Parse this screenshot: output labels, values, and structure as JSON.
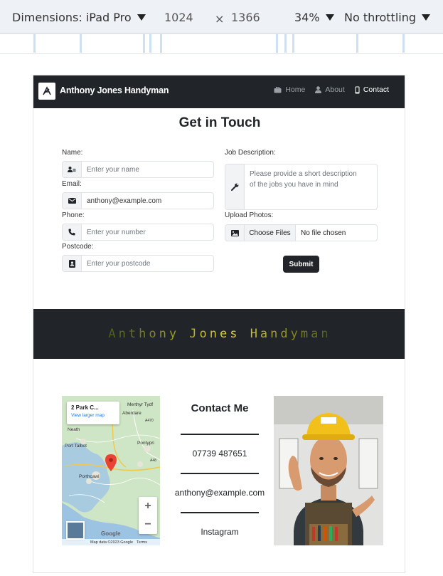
{
  "devtools": {
    "dimensions_label": "Dimensions: iPad Pro",
    "width": "1024",
    "times": "×",
    "height": "1366",
    "zoom": "34%",
    "throttling": "No throttling"
  },
  "nav": {
    "brand": "Anthony Jones Handyman",
    "links": [
      {
        "label": "Home",
        "icon": "briefcase-icon"
      },
      {
        "label": "About",
        "icon": "person-icon"
      },
      {
        "label": "Contact",
        "icon": "phone-icon"
      }
    ]
  },
  "form": {
    "title": "Get in Touch",
    "name": {
      "label": "Name:",
      "placeholder": "Enter your name"
    },
    "email": {
      "label": "Email:",
      "value": "anthony@example.com"
    },
    "phone": {
      "label": "Phone:",
      "placeholder": "Enter your number"
    },
    "postcode": {
      "label": "Postcode:",
      "placeholder": "Enter your postcode"
    },
    "job": {
      "label": "Job Description:",
      "placeholder_line1": "Please provide a short description",
      "placeholder_line2": "of the jobs you have in mind"
    },
    "photos": {
      "label": "Upload Photos:",
      "button": "Choose Files",
      "status": "No file chosen"
    },
    "submit": "Submit"
  },
  "banner": {
    "text": "Anthony Jones Handyman"
  },
  "map": {
    "card_title": "2 Park C...",
    "card_link": "View larger map",
    "places": [
      "Merthyr Tydf",
      "Aberdare",
      "Neath",
      "Port Talbot",
      "Pontypri",
      "Porthcawl",
      "A470",
      "A48"
    ],
    "footer_data": "Map data ©2023 Google",
    "footer_terms": "Terms",
    "brand": "Google",
    "zoom_in": "+",
    "zoom_out": "−"
  },
  "contact": {
    "title": "Contact Me",
    "phone": "07739 487651",
    "email": "anthony@example.com",
    "social": "Instagram"
  }
}
